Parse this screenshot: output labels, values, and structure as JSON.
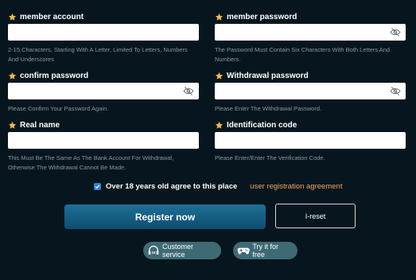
{
  "form": {
    "member_account": {
      "label": "member account",
      "value": "",
      "hint": "2-15 Characters, Starting With A Letter, Limited To Letters, Numbers And Underscores"
    },
    "member_password": {
      "label": "member password",
      "value": "",
      "hint": "The Password Must Contain Six Characters With Both Letters And Numbers."
    },
    "confirm_password": {
      "label": "confirm password",
      "value": "",
      "hint": "Please Confirm Your Password Again."
    },
    "withdrawal_password": {
      "label": "Withdrawal password",
      "value": "",
      "hint": "Please Enter The Withdrawal Password."
    },
    "real_name": {
      "label": "Real name",
      "value": "",
      "hint": "This Must Be The Same As The Bank Account For Withdrawal, Otherwise The Withdrawal Cannot Be Made."
    },
    "identification_code": {
      "label": "Identification code",
      "value": "",
      "hint": "Please Enter/Enter The Verification Code."
    }
  },
  "agreement": {
    "text": "Over 18 years old agree to this place",
    "link": "user registration agreement",
    "checked": true
  },
  "buttons": {
    "register": "Register now",
    "reset": "I-reset",
    "customer_service": "Customer service",
    "try_free": "Try it for free"
  },
  "icons": {
    "star": "star-icon",
    "eye_hidden": "eye-slash-icon",
    "support": "headset-24-icon",
    "gamepad": "gamepad-icon"
  },
  "colors": {
    "background": "#07161e",
    "star": "#f0b84a",
    "link": "#f5a35a",
    "register_button": "#1a6890",
    "pill": "#3e6a73"
  }
}
